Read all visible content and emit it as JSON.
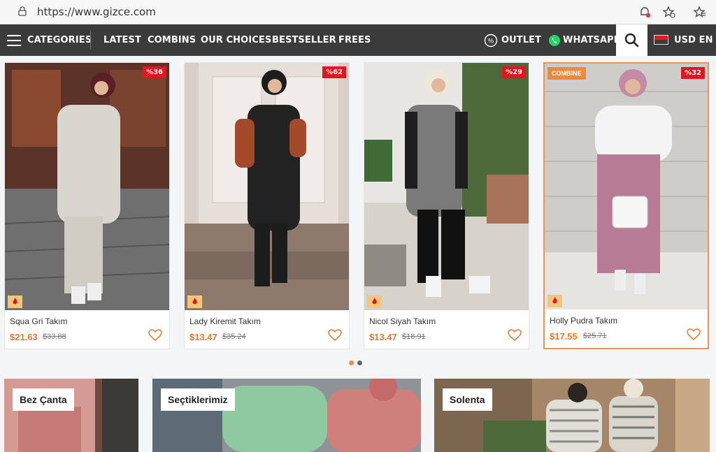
{
  "browser": {
    "url": "https://www.gizce.com"
  },
  "nav": {
    "categories": "CATEGORIES",
    "latest": "LATEST",
    "combins": "COMBINS",
    "our_choices": "OUR CHOICES",
    "bestseller": "BESTSELLER",
    "frees": "FREES",
    "outlet": "OUTLET",
    "whatsapp": "WHATSAPP",
    "currency_lang": "USD  EN"
  },
  "products": [
    {
      "name": "Squa Gri Takım",
      "price": "$21.63",
      "old_price": "$33.88",
      "discount": "%36"
    },
    {
      "name": "Lady Kiremit Takım",
      "price": "$13.47",
      "old_price": "$35.24",
      "discount": "%62"
    },
    {
      "name": "Nicol Siyah Takım",
      "price": "$13.47",
      "old_price": "$18.91",
      "discount": "%29"
    },
    {
      "name": "Holly Pudra Takım",
      "price": "$17.55",
      "old_price": "$25.71",
      "discount": "%32",
      "tag": "COMBINE"
    }
  ],
  "banners": [
    {
      "label": "Bez Çanta"
    },
    {
      "label": "Seçtiklerimiz"
    },
    {
      "label": "Solenta"
    }
  ],
  "colors": {
    "nav_bg": "#3b3b3b",
    "accent": "#e2792f",
    "discount": "#e4151f"
  }
}
